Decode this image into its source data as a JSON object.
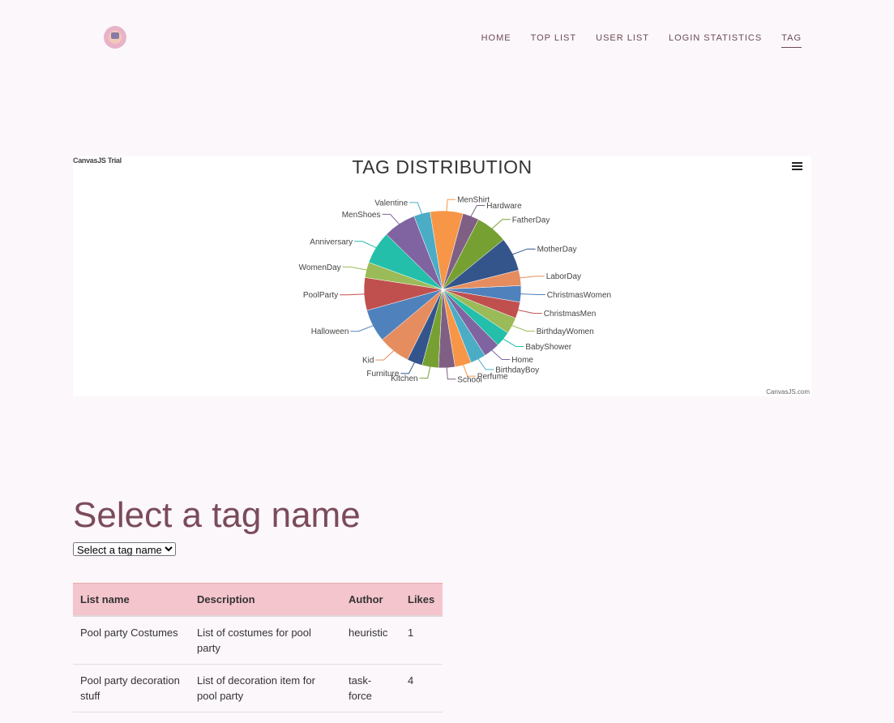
{
  "nav": {
    "items": [
      "HOME",
      "TOP LIST",
      "USER LIST",
      "LOGIN STATISTICS",
      "TAG"
    ],
    "active": "TAG"
  },
  "chart": {
    "trial_text": "CanvasJS Trial",
    "credit": "CanvasJS.com",
    "menu_icon": "hamburger-menu-icon"
  },
  "chart_data": {
    "type": "pie",
    "title": "TAG DISTRIBUTION",
    "slices": [
      {
        "label": "MenShirt",
        "value": 3.4,
        "color": "#F79647"
      },
      {
        "label": "Hardware",
        "value": 1.7,
        "color": "#7F6084"
      },
      {
        "label": "FatherDay",
        "value": 3.3,
        "color": "#77A033"
      },
      {
        "label": "MotherDay",
        "value": 3.5,
        "color": "#33558B"
      },
      {
        "label": "LaborDay",
        "value": 1.6,
        "color": "#E68D5F"
      },
      {
        "label": "ChristmasWomen",
        "value": 1.7,
        "color": "#4F81BC"
      },
      {
        "label": "ChristmasMen",
        "value": 1.7,
        "color": "#C0504E"
      },
      {
        "label": "BirthdayWomen",
        "value": 1.7,
        "color": "#9BBB58"
      },
      {
        "label": "BabyShower",
        "value": 1.6,
        "color": "#23BFAA"
      },
      {
        "label": "Home",
        "value": 1.7,
        "color": "#8064A1"
      },
      {
        "label": "BirthdayBoy",
        "value": 1.6,
        "color": "#4AACC5"
      },
      {
        "label": "Perfume",
        "value": 1.7,
        "color": "#F79647"
      },
      {
        "label": "School",
        "value": 1.7,
        "color": "#7F6084"
      },
      {
        "label": "Kitchen",
        "value": 1.7,
        "color": "#77A033"
      },
      {
        "label": "Furniture",
        "value": 1.6,
        "color": "#33558B"
      },
      {
        "label": "Kid",
        "value": 3.3,
        "color": "#E68D5F"
      },
      {
        "label": "Halloween",
        "value": 3.4,
        "color": "#4F81BC"
      },
      {
        "label": "PoolParty",
        "value": 3.4,
        "color": "#C0504E"
      },
      {
        "label": "WomenDay",
        "value": 1.6,
        "color": "#9BBB58"
      },
      {
        "label": "Anniversary",
        "value": 3.4,
        "color": "#23BFAA"
      },
      {
        "label": "MenShoes",
        "value": 3.4,
        "color": "#8064A1"
      },
      {
        "label": "Valentine",
        "value": 1.7,
        "color": "#4AACC5"
      }
    ]
  },
  "section": {
    "heading": "Select a tag name",
    "select_selected": "Select a tag name"
  },
  "table": {
    "headers": [
      "List name",
      "Description",
      "Author",
      "Likes"
    ],
    "rows": [
      [
        "Pool party Costumes",
        "List of costumes for pool party",
        "heuristic",
        "1"
      ],
      [
        "Pool party decoration stuff",
        "List of decoration item for pool party",
        "task-force",
        "4"
      ]
    ]
  }
}
